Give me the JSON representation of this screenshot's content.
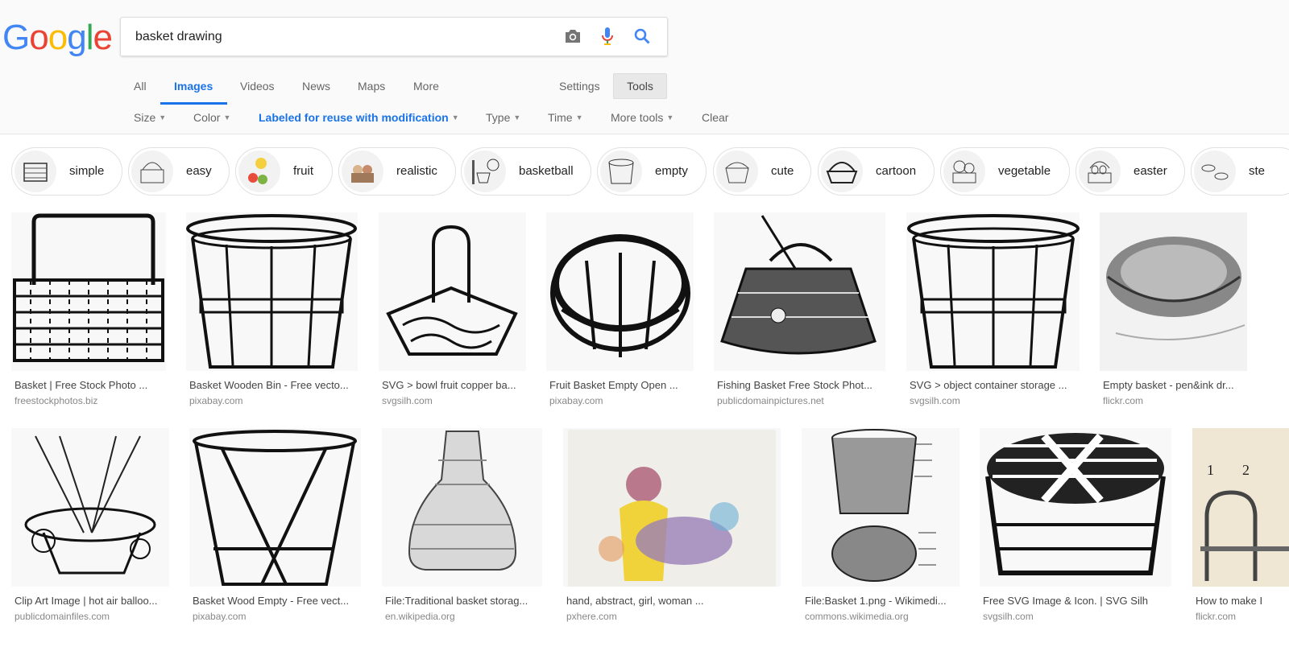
{
  "logo": {
    "letters": [
      "G",
      "o",
      "o",
      "g",
      "l",
      "e"
    ],
    "colors": [
      "#4285F4",
      "#EA4335",
      "#FBBC05",
      "#4285F4",
      "#34A853",
      "#EA4335"
    ]
  },
  "search": {
    "value": "basket drawing",
    "icons": [
      "camera-icon",
      "microphone-icon",
      "search-icon"
    ]
  },
  "tabs": [
    "All",
    "Images",
    "Videos",
    "News",
    "Maps",
    "More"
  ],
  "settings_label": "Settings",
  "tools_label": "Tools",
  "filters": [
    "Size",
    "Color",
    "Labeled for reuse with modification",
    "Type",
    "Time",
    "More tools"
  ],
  "clear_label": "Clear",
  "chips": [
    "simple",
    "easy",
    "fruit",
    "realistic",
    "basketball",
    "empty",
    "cute",
    "cartoon",
    "vegetable",
    "easter",
    "ste"
  ],
  "results_row1": [
    {
      "title": "Basket | Free Stock Photo ...",
      "source": "freestockphotos.biz"
    },
    {
      "title": "Basket Wooden Bin - Free vecto...",
      "source": "pixabay.com"
    },
    {
      "title": "SVG > bowl fruit copper ba...",
      "source": "svgsilh.com"
    },
    {
      "title": "Fruit Basket Empty Open ...",
      "source": "pixabay.com"
    },
    {
      "title": "Fishing Basket Free Stock Phot...",
      "source": "publicdomainpictures.net"
    },
    {
      "title": "SVG > object container storage ...",
      "source": "svgsilh.com"
    },
    {
      "title": "Empty basket - pen&ink dr...",
      "source": "flickr.com"
    }
  ],
  "results_row2": [
    {
      "title": "Clip Art Image | hot air balloo...",
      "source": "publicdomainfiles.com"
    },
    {
      "title": "Basket Wood Empty - Free vect...",
      "source": "pixabay.com"
    },
    {
      "title": "File:Traditional basket storag...",
      "source": "en.wikipedia.org"
    },
    {
      "title": "hand, abstract, girl, woman ...",
      "source": "pxhere.com"
    },
    {
      "title": "File:Basket 1.png - Wikimedi...",
      "source": "commons.wikimedia.org"
    },
    {
      "title": "Free SVG Image & Icon. | SVG Silh",
      "source": "svgsilh.com"
    },
    {
      "title": "How to make I",
      "source": "flickr.com"
    }
  ],
  "row2_last_image_labels": [
    "1",
    "2"
  ]
}
